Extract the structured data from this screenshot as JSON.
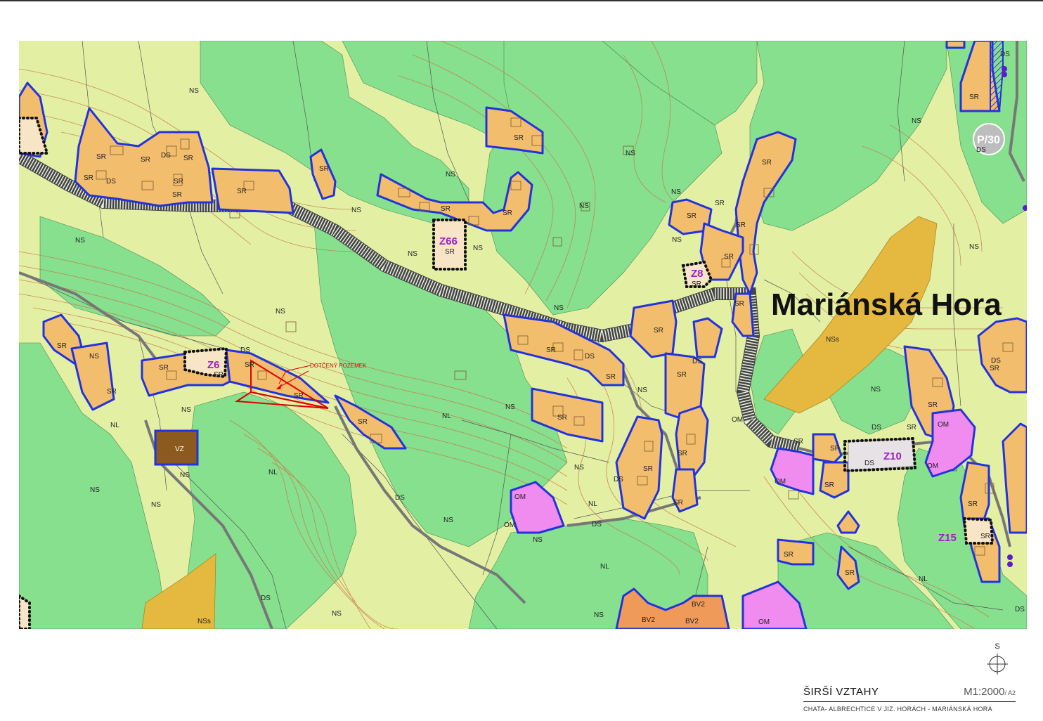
{
  "map": {
    "place_name": "Mariánská Hora",
    "annotation": "DOTČENÝ POZEMEK",
    "zones": [
      "Z66",
      "Z8",
      "Z6",
      "Z10",
      "Z15"
    ],
    "label_codes": {
      "sr": "SR",
      "ns": "NS",
      "nss": "NSs",
      "ds": "DS",
      "nl": "NL",
      "om": "OM",
      "vz": "VZ",
      "bv2": "BV2"
    },
    "route_marker": "P/30",
    "colors": {
      "meadow": "#e3f0a4",
      "forest": "#86e08e",
      "residential": "#f2bd6c",
      "civic": "#f08cf0",
      "agriculture": "#e5b83f",
      "sports": "#8c5a1e",
      "mixed": "#f09a5a",
      "border": "#2233dd",
      "contour": "#c77a4a",
      "road": "#555555",
      "annotation": "#e00000",
      "zone_label": "#a020c0"
    }
  },
  "title_block": {
    "title": "ŠIRŠÍ VZTAHY",
    "scale": "M1:2000",
    "paper": "/ A2",
    "subtitle": "CHATA- ALBRECHTICE V JIZ. HORÁCH - MARIÁNSKÁ HORA"
  },
  "north_label": "S"
}
